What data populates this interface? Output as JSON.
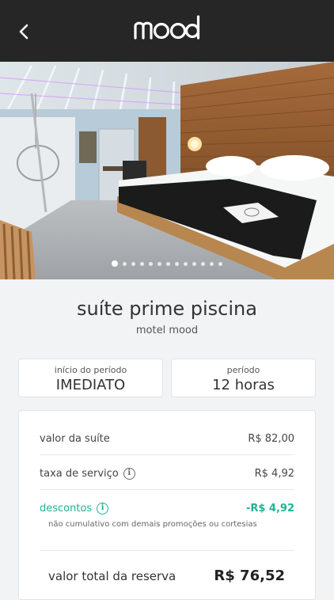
{
  "header": {
    "back_icon": "chevron-left-icon",
    "logo_text": "mood"
  },
  "gallery": {
    "image_description_icon": "suite-photo",
    "total_slides": 13,
    "active_index": 0
  },
  "suite": {
    "title": "suíte prime piscina",
    "motel": "motel mood"
  },
  "period": {
    "start_label": "início do período",
    "start_value": "IMEDIATO",
    "duration_label": "período",
    "duration_value": "12 horas"
  },
  "pricing": {
    "suite_label": "valor da suíte",
    "suite_value": "R$ 82,00",
    "service_label": "taxa de serviço",
    "service_value": "R$ 4,92",
    "discount_label": "descontos",
    "discount_value": "-R$ 4,92",
    "discount_note": "não cumulativo com demais promoções ou cortesias",
    "total_label": "valor total da reserva",
    "total_value": "R$ 76,52"
  },
  "colors": {
    "header_bg": "#262626",
    "accent_green": "#22b394",
    "page_bg": "#f2f3f5"
  }
}
